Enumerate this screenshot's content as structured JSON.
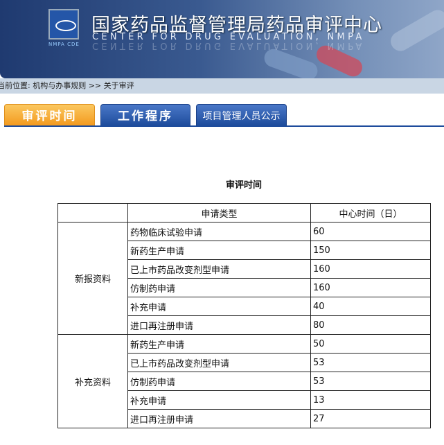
{
  "header": {
    "title_cn": "国家药品监督管理局药品审评中心",
    "title_en": "CENTER FOR DRUG EVALUATION, NMPA",
    "logo_text": "NMPA CDE"
  },
  "breadcrumb": {
    "prefix": "当前位置:",
    "items": [
      "机构与办事规则",
      ">>",
      "关于审评"
    ]
  },
  "tabs": [
    {
      "label": "审评时间",
      "active": true
    },
    {
      "label": "工作程序"
    },
    {
      "label": "项目管理人员公示"
    }
  ],
  "page_title": "审评时间",
  "table": {
    "headers": [
      "",
      "申请类型",
      "中心时间（日）"
    ],
    "groups": [
      {
        "name": "新报资料",
        "rows": [
          [
            "药物临床试验申请",
            "60"
          ],
          [
            "新药生产申请",
            "150"
          ],
          [
            "已上市药品改变剂型申请",
            "160"
          ],
          [
            "仿制药申请",
            "160"
          ],
          [
            "补充申请",
            "40"
          ],
          [
            "进口再注册申请",
            "80"
          ]
        ]
      },
      {
        "name": "补充资料",
        "rows": [
          [
            "新药生产申请",
            "50"
          ],
          [
            "已上市药品改变剂型申请",
            "53"
          ],
          [
            "仿制药申请",
            "53"
          ],
          [
            "补充申请",
            "13"
          ],
          [
            "进口再注册申请",
            "27"
          ]
        ]
      }
    ]
  }
}
